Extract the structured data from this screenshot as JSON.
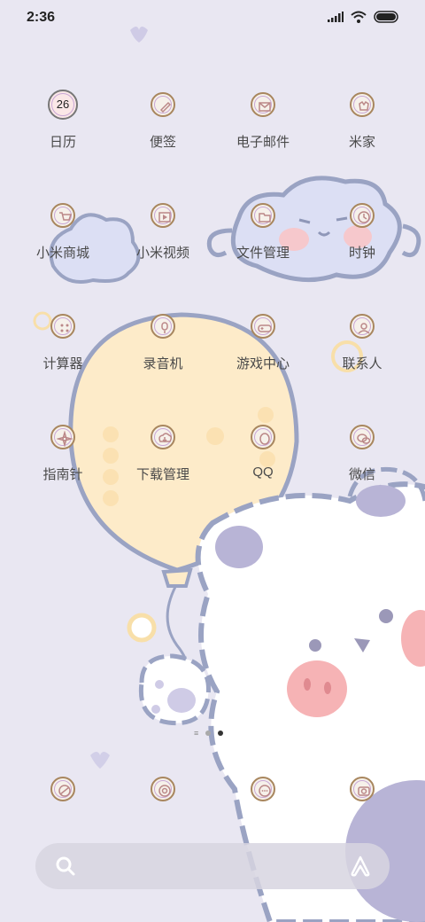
{
  "status_bar": {
    "time": "2:36",
    "icons": [
      "signal-icon",
      "wifi-icon",
      "battery-icon"
    ]
  },
  "grid": [
    {
      "label": "日历",
      "icon": "calendar-icon",
      "badge": "26"
    },
    {
      "label": "便签",
      "icon": "notes-icon"
    },
    {
      "label": "电子邮件",
      "icon": "mail-icon"
    },
    {
      "label": "米家",
      "icon": "mijia-icon"
    },
    {
      "label": "小米商城",
      "icon": "cart-icon"
    },
    {
      "label": "小米视频",
      "icon": "video-icon"
    },
    {
      "label": "文件管理",
      "icon": "folder-icon"
    },
    {
      "label": "时钟",
      "icon": "clock-icon"
    },
    {
      "label": "计算器",
      "icon": "calculator-icon"
    },
    {
      "label": "录音机",
      "icon": "microphone-icon"
    },
    {
      "label": "游戏中心",
      "icon": "gamepad-icon"
    },
    {
      "label": "联系人",
      "icon": "contacts-icon"
    },
    {
      "label": "指南针",
      "icon": "compass-icon"
    },
    {
      "label": "下载管理",
      "icon": "download-icon"
    },
    {
      "label": "QQ",
      "icon": "qq-icon"
    },
    {
      "label": "微信",
      "icon": "wechat-icon"
    }
  ],
  "page_indicator": {
    "pages": 3,
    "current": 3
  },
  "dock": [
    {
      "icon": "browser-icon"
    },
    {
      "icon": "chrome-icon"
    },
    {
      "icon": "messages-icon"
    },
    {
      "icon": "camera-icon"
    }
  ],
  "search_bar": {
    "icon_left": "search-icon",
    "icon_right": "xiaoai-icon"
  }
}
